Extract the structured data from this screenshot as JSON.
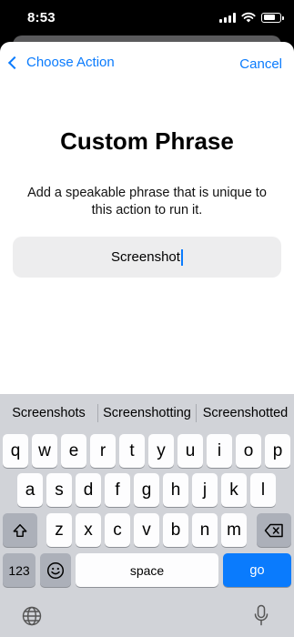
{
  "status_bar": {
    "time": "8:53",
    "battery_level": 0.75
  },
  "nav": {
    "back_label": "Choose Action",
    "cancel_label": "Cancel"
  },
  "content": {
    "title": "Custom Phrase",
    "description": "Add a speakable phrase that is unique to this action to run it.",
    "phrase_value": "Screenshot"
  },
  "keyboard": {
    "suggestions": [
      "Screenshots",
      "Screenshotting",
      "Screenshotted"
    ],
    "row1": [
      "q",
      "w",
      "e",
      "r",
      "t",
      "y",
      "u",
      "i",
      "o",
      "p"
    ],
    "row2": [
      "a",
      "s",
      "d",
      "f",
      "g",
      "h",
      "j",
      "k",
      "l"
    ],
    "row3": [
      "z",
      "x",
      "c",
      "v",
      "b",
      "n",
      "m"
    ],
    "numbers_label": "123",
    "space_label": "space",
    "go_label": "go"
  },
  "colors": {
    "accent": "#0a7bfd",
    "keyboard_bg": "#d1d3d8"
  }
}
